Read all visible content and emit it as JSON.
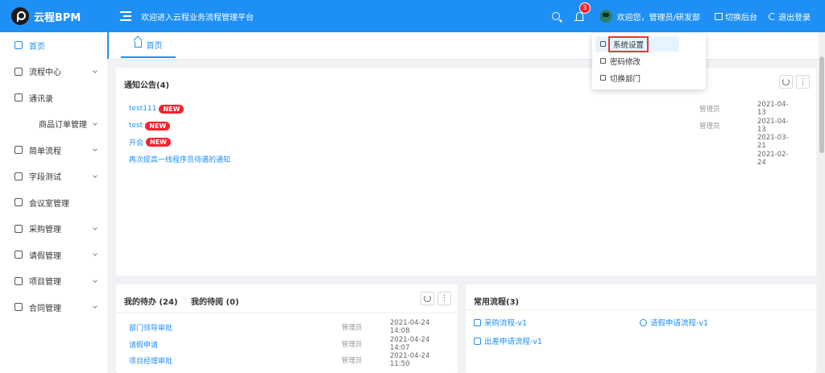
{
  "header": {
    "logo_text": "云程BPM",
    "welcome_title": "欢迎进入云程业务流程管理平台",
    "notification_count": "3",
    "user_text": "欢迎您，管理员/研发部",
    "switch_label": "切换后台",
    "logout_label": "退出登录",
    "brand_color": "#1e8ff5"
  },
  "sidebar": {
    "items": [
      {
        "label": "首页"
      },
      {
        "label": "流程中心"
      },
      {
        "label": "通讯录"
      },
      {
        "label": "商品订单管理"
      },
      {
        "label": "简单流程"
      },
      {
        "label": "字段测试"
      },
      {
        "label": "会议室管理"
      },
      {
        "label": "采购管理"
      },
      {
        "label": "请假管理"
      },
      {
        "label": "项目管理"
      },
      {
        "label": "合同管理"
      }
    ]
  },
  "tabs": [
    {
      "label": "首页"
    }
  ],
  "user_menu": {
    "items": [
      {
        "label": "系统设置"
      },
      {
        "label": "密码修改"
      },
      {
        "label": "切换部门"
      }
    ]
  },
  "notices": {
    "title": "通知公告(4)",
    "new_label": "NEW",
    "rows": [
      {
        "title": "test111",
        "author": "管理员",
        "date": "2021-04-13"
      },
      {
        "title": "test",
        "author": "管理员",
        "date": "2021-04-13"
      },
      {
        "title": "开会",
        "author": "",
        "date": "2021-03-21"
      },
      {
        "title": "再次提高一线程序员待遇的通知",
        "author": "",
        "date": "2021-02-24"
      }
    ]
  },
  "todo": {
    "tab_pending": "我的待办 (24)",
    "tab_read": "我的待阅 (0)",
    "rows": [
      {
        "name": "部门领导审批",
        "user": "管理员",
        "time": "2021-04-24 14:08"
      },
      {
        "name": "请假申请",
        "user": "管理员",
        "time": "2021-04-24 14:07"
      },
      {
        "name": "项目经理审批",
        "user": "管理员",
        "time": "2021-04-24 11:50"
      }
    ]
  },
  "common_flows": {
    "title": "常用流程(3)",
    "items": [
      {
        "label": "采购流程-v1"
      },
      {
        "label": "请假申请流程-v1"
      },
      {
        "label": "出差申请流程-v1"
      }
    ]
  }
}
